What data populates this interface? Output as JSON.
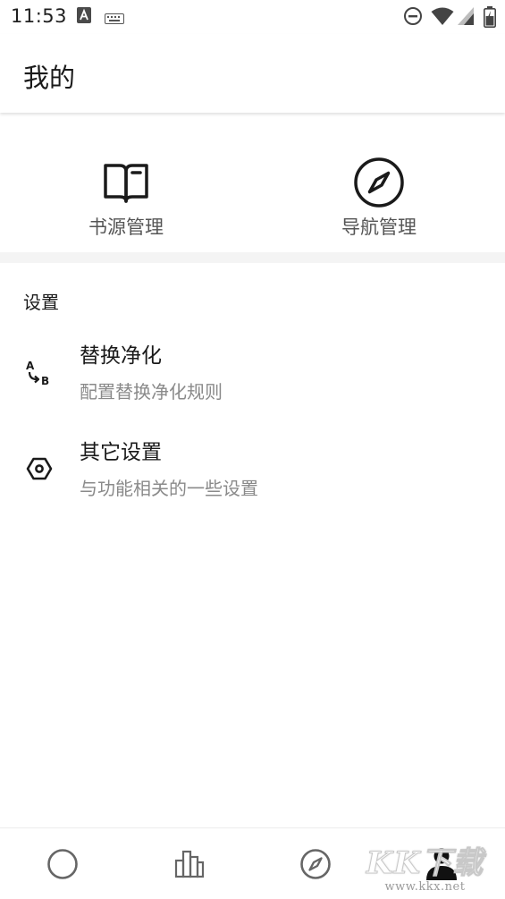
{
  "status_bar": {
    "time": "11:53",
    "left_icons": [
      "font-a-icon",
      "keyboard-icon"
    ],
    "right_icons": [
      "do-not-disturb-icon",
      "wifi-icon",
      "cellular-signal-icon",
      "battery-icon"
    ]
  },
  "app_bar": {
    "title": "我的"
  },
  "quick_actions": [
    {
      "label": "书源管理",
      "icon": "open-book-icon"
    },
    {
      "label": "导航管理",
      "icon": "compass-icon"
    }
  ],
  "settings": {
    "section_title": "设置",
    "items": [
      {
        "title": "替换净化",
        "description": "配置替换净化规则",
        "icon": "a-to-b-replace-icon"
      },
      {
        "title": "其它设置",
        "description": "与功能相关的一些设置",
        "icon": "hexagon-settings-icon"
      }
    ]
  },
  "bottom_nav": {
    "items": [
      {
        "icon": "circle-icon",
        "active": false
      },
      {
        "icon": "bookshelf-icon",
        "active": false
      },
      {
        "icon": "compass-icon",
        "active": false
      },
      {
        "icon": "person-icon",
        "active": true
      }
    ]
  },
  "watermark": {
    "brand": "KK下载",
    "url": "www.kkx.net"
  },
  "colors": {
    "primary_text": "#1a1a1a",
    "secondary_text": "#8a8a8a",
    "label_text": "#555555",
    "divider": "#f4f4f4",
    "inactive_icon": "#666666"
  }
}
